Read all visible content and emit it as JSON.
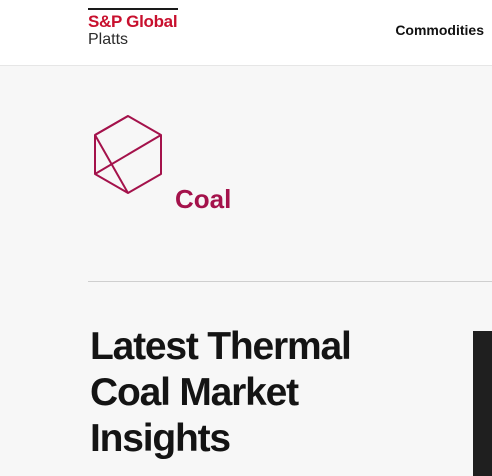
{
  "header": {
    "logo": {
      "brand": "S&P Global",
      "sub": "Platts"
    },
    "nav": {
      "commodities_label": "Commodities"
    }
  },
  "hero": {
    "icon": "coal-hexagon-icon",
    "category_label": "Coal",
    "headline": "Latest Thermal Coal Market Insights"
  },
  "colors": {
    "brand_red": "#c8102e",
    "coal_magenta": "#a4124b",
    "text_dark": "#141414",
    "background": "#f7f7f7"
  }
}
